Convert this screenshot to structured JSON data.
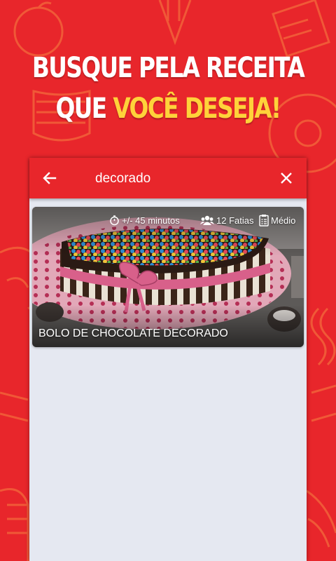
{
  "promo": {
    "headline_line1": "BUSQUE PELA RECEITA",
    "headline_line2_part1": "QUE ",
    "headline_line2_accent": "VOCÊ DESEJA!",
    "accent_color": "#ffd23a",
    "background_color": "#e8262b"
  },
  "appbar": {
    "back_icon": "arrow-left-icon",
    "search_value": "decorado",
    "close_icon": "close-icon"
  },
  "results": [
    {
      "title": "BOLO DE CHOCOLATE DECORADO",
      "time": "+/- 45 minutos",
      "time_icon": "stopwatch-icon",
      "servings": "12 Fatias",
      "servings_icon": "people-icon",
      "difficulty": "Médio",
      "difficulty_icon": "clipboard-icon"
    }
  ]
}
